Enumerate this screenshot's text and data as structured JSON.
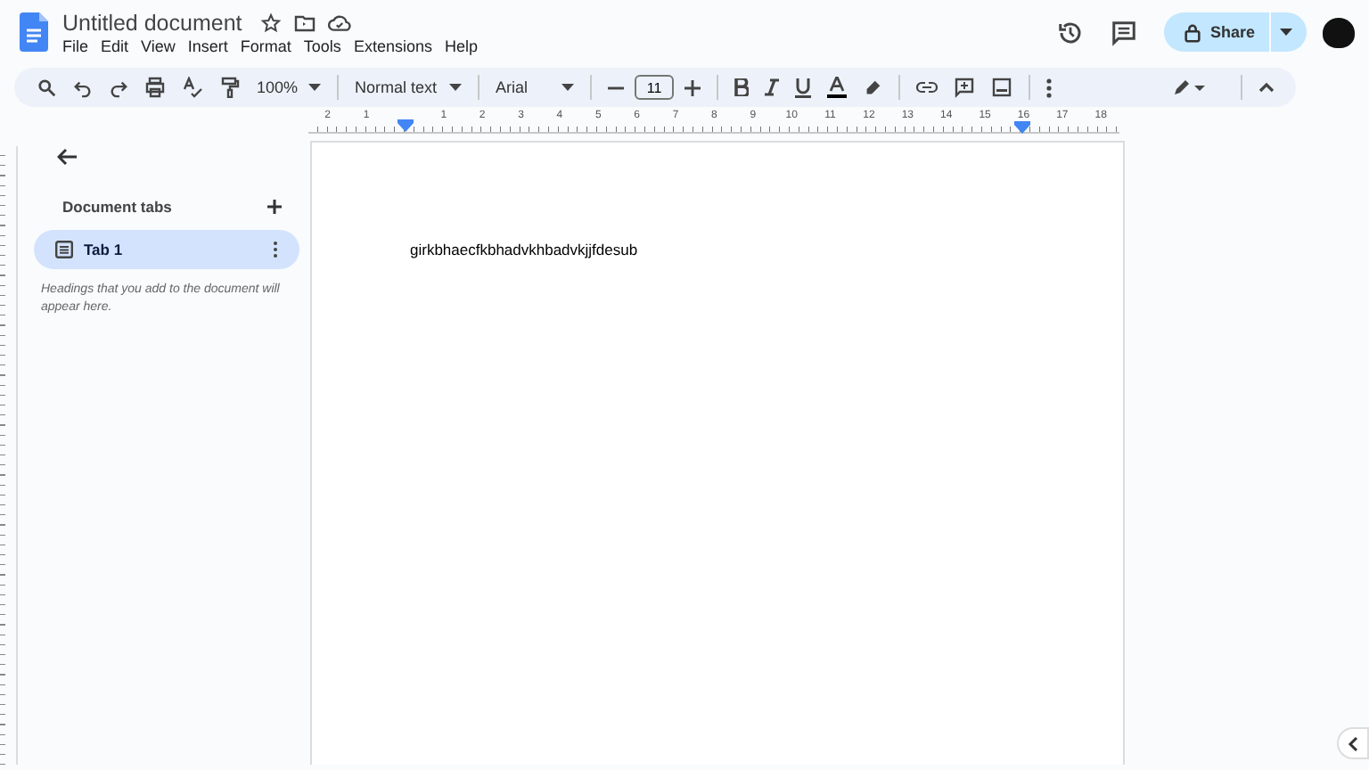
{
  "document": {
    "title": "Untitled document"
  },
  "menu": [
    "File",
    "Edit",
    "View",
    "Insert",
    "Format",
    "Tools",
    "Extensions",
    "Help"
  ],
  "share_button": {
    "label": "Share"
  },
  "toolbar": {
    "zoom": "100%",
    "style": "Normal text",
    "font": "Arial",
    "font_size": "11"
  },
  "ruler": {
    "left_numbers": [
      "2",
      "1"
    ],
    "numbers": [
      "1",
      "2",
      "3",
      "4",
      "5",
      "6",
      "7",
      "8",
      "9",
      "10",
      "11",
      "12",
      "13",
      "14",
      "15",
      "16",
      "17",
      "18"
    ]
  },
  "sidebar": {
    "heading": "Document tabs",
    "tabs": [
      {
        "label": "Tab 1",
        "selected": true
      }
    ],
    "hint": "Headings that you add to the document will appear here."
  },
  "page": {
    "text": "girkbhaecfkbhadvkhbadvkjjfdesub"
  }
}
